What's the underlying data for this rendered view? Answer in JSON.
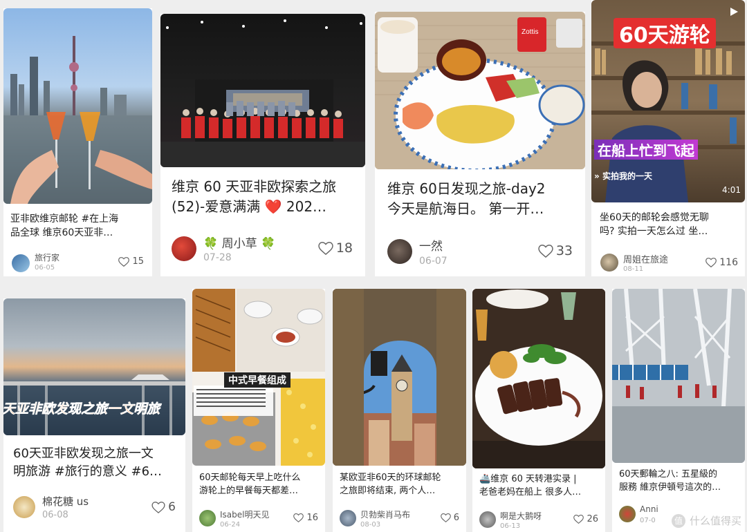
{
  "cards": [
    {
      "title_lines": [
        "亚非欧维京邮轮 #在上海",
        "品全球  维京60天亚非…"
      ],
      "author": "旅行家",
      "date": "06-05",
      "likes": "15"
    },
    {
      "title_lines": [
        "维京 60 天亚非欧探索之旅",
        "(52)-爱意满满 ❤️ 202…"
      ],
      "author": "🍀 周小草 🍀",
      "date": "07-28",
      "likes": "18"
    },
    {
      "title_lines": [
        "维京 60日发现之旅-day2",
        "今天是航海日。 第一开…"
      ],
      "author": "一然",
      "date": "06-07",
      "likes": "33"
    },
    {
      "title_lines": [
        "坐60天的邮轮会感觉无聊",
        "吗? 实拍一天怎么过 坐…"
      ],
      "author": "周姐在旅途",
      "date": "08-11",
      "likes": "116"
    },
    {
      "title_lines": [
        "60天亚非欧发现之旅一文",
        "明旅游 #旅行的意义  #6…"
      ],
      "author": "棉花糖 us",
      "date": "06-08",
      "likes": "6"
    },
    {
      "title_lines": [
        "60天邮轮每天早上吃什么",
        "游轮上的早餐每天都差…"
      ],
      "author": "Isabel明天见",
      "date": "06-24",
      "likes": "16"
    },
    {
      "title_lines": [
        "某欧亚非60天的环球邮轮",
        "之旅即将结束, 两个人…"
      ],
      "author": "贝勃柴肖马布",
      "date": "08-03",
      "likes": "6"
    },
    {
      "title_lines": [
        "🚢维京 60 天转港实录 |",
        "老爸老妈在船上 很多人…"
      ],
      "author": "啊是大鹅呀",
      "date": "06-13",
      "likes": "26"
    },
    {
      "title_lines": [
        "60天郵輪之八: 五星級的",
        "服務 維京伊頓号這次的…"
      ],
      "author": "Anni",
      "date": "07-0",
      "likes": ""
    }
  ],
  "overlays": {
    "c4_top": "60天游轮",
    "c4_mid": "在船上忙到飞起",
    "c4_tag": "实拍我的一天",
    "c4_time": "4:01",
    "c5_band": "天亚非欧发现之旅一文明旅",
    "c6_label": "中式早餐组成",
    "c8_brand": "Zottis"
  },
  "watermark": {
    "badge": "值",
    "text": "什么值得买"
  },
  "colors": {
    "accent_red": "#e02020",
    "heart": "#666666",
    "text": "#222222",
    "muted": "#aaaaaa"
  }
}
